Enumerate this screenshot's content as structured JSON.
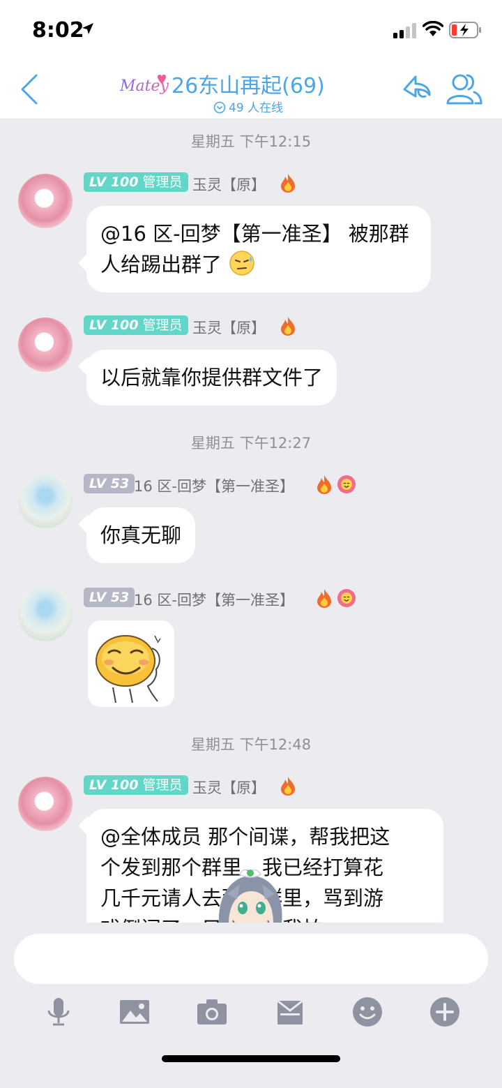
{
  "status_bar": {
    "time": "8:02"
  },
  "header": {
    "logo_text": "Matey",
    "title": "26东山再起(69)",
    "online_text": "49 人在线"
  },
  "messages": [
    {
      "time_label": "星期五 下午12:15",
      "badge_level": "LV 100",
      "badge_role": "管理员",
      "sender": "玉灵【原】",
      "text": "@16 区-回梦【第一准圣】 被那群人给踢出群了"
    },
    {
      "badge_level": "LV 100",
      "badge_role": "管理员",
      "sender": "玉灵【原】",
      "text": "以后就靠你提供群文件了"
    },
    {
      "time_label": "星期五 下午12:27",
      "badge_level": "LV 53",
      "sender": "16 区-回梦【第一准圣】",
      "text": "你真无聊"
    },
    {
      "badge_level": "LV 53",
      "sender": "16 区-回梦【第一准圣】",
      "sticker": "smile-sticker"
    },
    {
      "time_label": "星期五 下午12:48",
      "badge_level": "LV 100",
      "badge_role": "管理员",
      "sender": "玉灵【原】",
      "text_lines": [
        "@全体成员 那个间谍，帮我把这",
        "个发到那个群里，我已经打算花",
        "几千元请人去那个群里，骂到游",
        "戏倒闭了，只是……我怕"
      ]
    }
  ],
  "composer": {
    "input_value": "",
    "tools": [
      "microphone-icon",
      "image-icon",
      "camera-icon",
      "gift-box-icon",
      "emoji-icon",
      "plus-icon"
    ]
  },
  "colors": {
    "accent": "#4aa6e8",
    "admin_badge": "#62d6c8",
    "level_badge": "#b5b7c7",
    "background": "#ebebf0"
  }
}
